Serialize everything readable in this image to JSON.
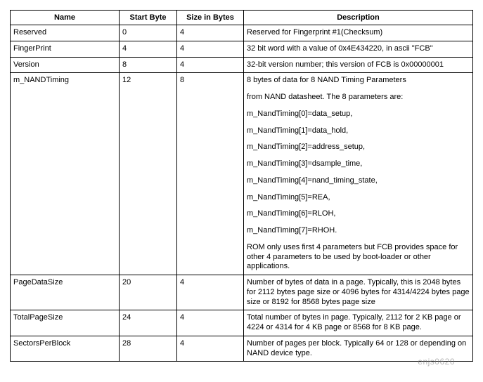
{
  "headers": {
    "name": "Name",
    "start": "Start Byte",
    "size": "Size in Bytes",
    "desc": "Description"
  },
  "rows": [
    {
      "name": "Reserved",
      "start": "0",
      "size": "4",
      "desc": [
        "Reserved for Fingerprint #1(Checksum)"
      ]
    },
    {
      "name": "FingerPrint",
      "start": "4",
      "size": "4",
      "desc": [
        "32 bit word with a value of 0x4E434220, in ascii \"FCB\""
      ]
    },
    {
      "name": "Version",
      "start": "8",
      "size": "4",
      "desc": [
        "32-bit version number; this version of FCB is 0x00000001"
      ]
    },
    {
      "name": "m_NANDTiming",
      "start": "12",
      "size": "8",
      "desc": [
        "8 bytes of data for 8 NAND Timing Parameters",
        "from NAND datasheet. The 8 parameters are:",
        "m_NandTiming[0]=data_setup,",
        "m_NandTiming[1]=data_hold,",
        "m_NandTiming[2]=address_setup,",
        "m_NandTiming[3]=dsample_time,",
        "m_NandTiming[4]=nand_timing_state,",
        "m_NandTiming[5]=REA,",
        "m_NandTiming[6]=RLOH,",
        "m_NandTiming[7]=RHOH.",
        "ROM only uses first 4 parameters but FCB provides space for other 4 parameters to be used by boot-loader or other applications."
      ]
    },
    {
      "name": "PageDataSize",
      "start": "20",
      "size": "4",
      "desc": [
        "Number of bytes of data in a page. Typically, this is 2048 bytes for 2112 bytes page size or 4096 bytes for 4314/4224 bytes page size or 8192 for 8568 bytes page size"
      ]
    },
    {
      "name": "TotalPageSize",
      "start": "24",
      "size": "4",
      "desc": [
        "Total number of bytes in page. Typically, 2112 for 2 KB page or 4224 or 4314 for 4 KB page or 8568 for 8 KB page."
      ]
    },
    {
      "name": "SectorsPerBlock",
      "start": "28",
      "size": "4",
      "desc": [
        "Number of pages per block. Typically 64 or 128 or depending on NAND device type."
      ]
    }
  ],
  "watermark": "enjs0620"
}
